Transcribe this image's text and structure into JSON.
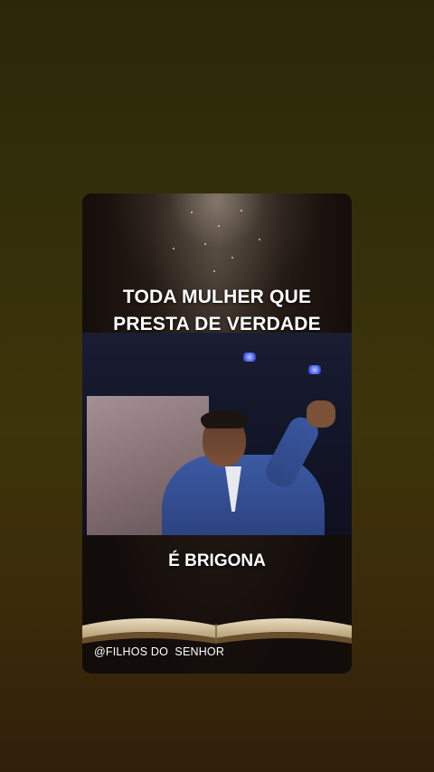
{
  "headline": {
    "line1": "TODA MULHER QUE",
    "line2": "PRESTA DE VERDADE"
  },
  "caption": "É BRIGONA",
  "watermark": "@FILHOS DO  SENHOR",
  "colors": {
    "background_top": "#2b2708",
    "background_bottom": "#321f0b",
    "text": "#ffffff",
    "suit": "#3c5aa3"
  },
  "icons": [
    "open-bible-icon"
  ]
}
